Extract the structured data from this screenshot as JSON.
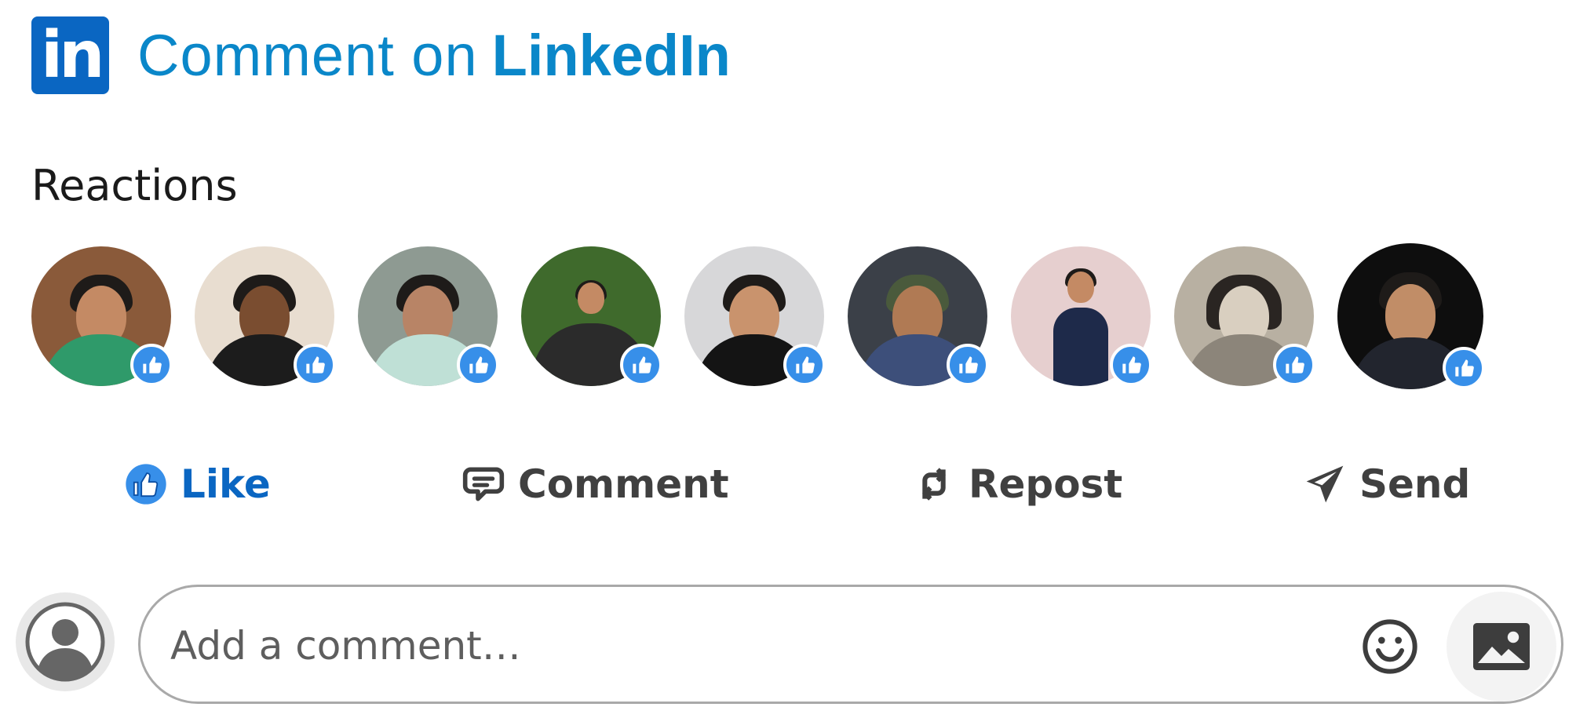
{
  "header": {
    "logo_text": "in",
    "title_prefix": "Comment on",
    "title_brand": "LinkedIn"
  },
  "reactions": {
    "label": "Reactions",
    "avatars": [
      {
        "name": "avatar-1"
      },
      {
        "name": "avatar-2"
      },
      {
        "name": "avatar-3"
      },
      {
        "name": "avatar-4"
      },
      {
        "name": "avatar-5"
      },
      {
        "name": "avatar-6"
      },
      {
        "name": "avatar-7"
      },
      {
        "name": "avatar-8"
      },
      {
        "name": "avatar-9"
      }
    ],
    "badge_icon": "thumbs-up-icon"
  },
  "actions": {
    "like": {
      "label": "Like",
      "icon": "thumbs-up-icon",
      "color": "#0a66c2"
    },
    "comment": {
      "label": "Comment",
      "icon": "comment-icon"
    },
    "repost": {
      "label": "Repost",
      "icon": "repost-icon"
    },
    "send": {
      "label": "Send",
      "icon": "send-icon"
    }
  },
  "comment_box": {
    "placeholder": "Add a comment…",
    "emoji_icon": "emoji-icon",
    "photo_icon": "photo-icon"
  },
  "colors": {
    "brand": "#0a66c2",
    "title": "#0a87c9",
    "badge": "#378fe9"
  }
}
